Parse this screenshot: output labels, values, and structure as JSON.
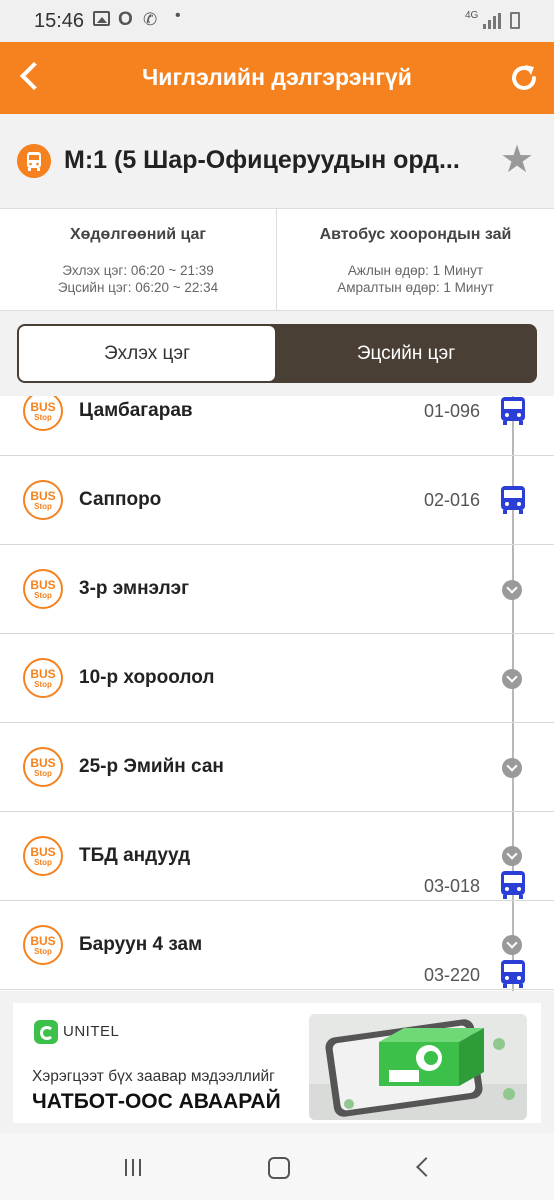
{
  "status_bar": {
    "time": "15:46",
    "network": "4G",
    "icons": [
      "image-icon",
      "opera-icon",
      "missed-call-icon",
      "dot-icon",
      "signal-icon",
      "battery-icon"
    ]
  },
  "header": {
    "title": "Чиглэлийн дэлгэрэнгүй",
    "back_icon": "back-arrow-icon",
    "refresh_icon": "refresh-icon",
    "color": "#f5821f"
  },
  "route": {
    "name": "М:1 (5 Шар-Офицеруудын орд...",
    "icon": "bus-icon",
    "favorite_icon": "star-icon"
  },
  "info": {
    "operating": {
      "title": "Хөдөлгөөний цаг",
      "line1": "Эхлэх цэг: 06:20 ~ 21:39",
      "line2": "Эцсийн цэг: 06:20 ~ 22:34"
    },
    "interval": {
      "title": "Автобус хоорондын зай",
      "line1": "Ажлын өдөр: 1 Минут",
      "line2": "Амралтын өдөр: 1 Минут"
    }
  },
  "direction_tabs": [
    {
      "label": "Эхлэх цэг",
      "selected": true
    },
    {
      "label": "Эцсийн цэг",
      "selected": false
    }
  ],
  "stop_badge": {
    "line1": "BUS",
    "line2": "Stop"
  },
  "stops": [
    {
      "name": "Цамбагарав",
      "bus_code": "01-096",
      "marker": "bus"
    },
    {
      "name": "Саппоро",
      "bus_code": "02-016",
      "marker": "bus"
    },
    {
      "name": "3-р эмнэлэг",
      "bus_code": "",
      "marker": "chevron"
    },
    {
      "name": "10-р хороолол",
      "bus_code": "",
      "marker": "chevron"
    },
    {
      "name": "25-р Эмийн сан",
      "bus_code": "",
      "marker": "chevron"
    },
    {
      "name": "ТБД андууд",
      "bus_code": "03-018",
      "marker": "chevron+bus"
    },
    {
      "name": "Баруун 4 зам",
      "bus_code": "03-220",
      "marker": "chevron+bus"
    }
  ],
  "ad": {
    "brand": "UNITEL",
    "line1": "Хэрэгцээт бүх заавар мэдээллийг",
    "line2": "ЧАТБОТ-ООС АВААРАЙ"
  },
  "nav_bar": {
    "icons": [
      "recent-apps-icon",
      "home-icon",
      "back-icon"
    ]
  }
}
